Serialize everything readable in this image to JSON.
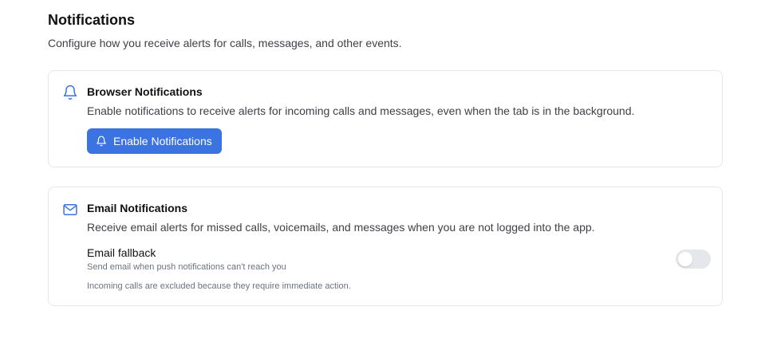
{
  "header": {
    "title": "Notifications",
    "subtitle": "Configure how you receive alerts for calls, messages, and other events."
  },
  "browser_notifications": {
    "icon": "bell-icon",
    "title": "Browser Notifications",
    "description": "Enable notifications to receive alerts for incoming calls and messages, even when the tab is in the background.",
    "button_label": "Enable Notifications",
    "button_icon": "bell-icon",
    "button_color": "#3b73e0"
  },
  "email_notifications": {
    "icon": "mail-icon",
    "title": "Email Notifications",
    "description": "Receive email alerts for missed calls, voicemails, and messages when you are not logged into the app.",
    "fallback": {
      "label": "Email fallback",
      "sublabel": "Send email when push notifications can't reach you",
      "enabled": false
    },
    "note": "Incoming calls are excluded because they require immediate action."
  },
  "colors": {
    "accent": "#3b73e0",
    "icon": "#3b73e0",
    "toggle_off": "#e5e7eb"
  }
}
